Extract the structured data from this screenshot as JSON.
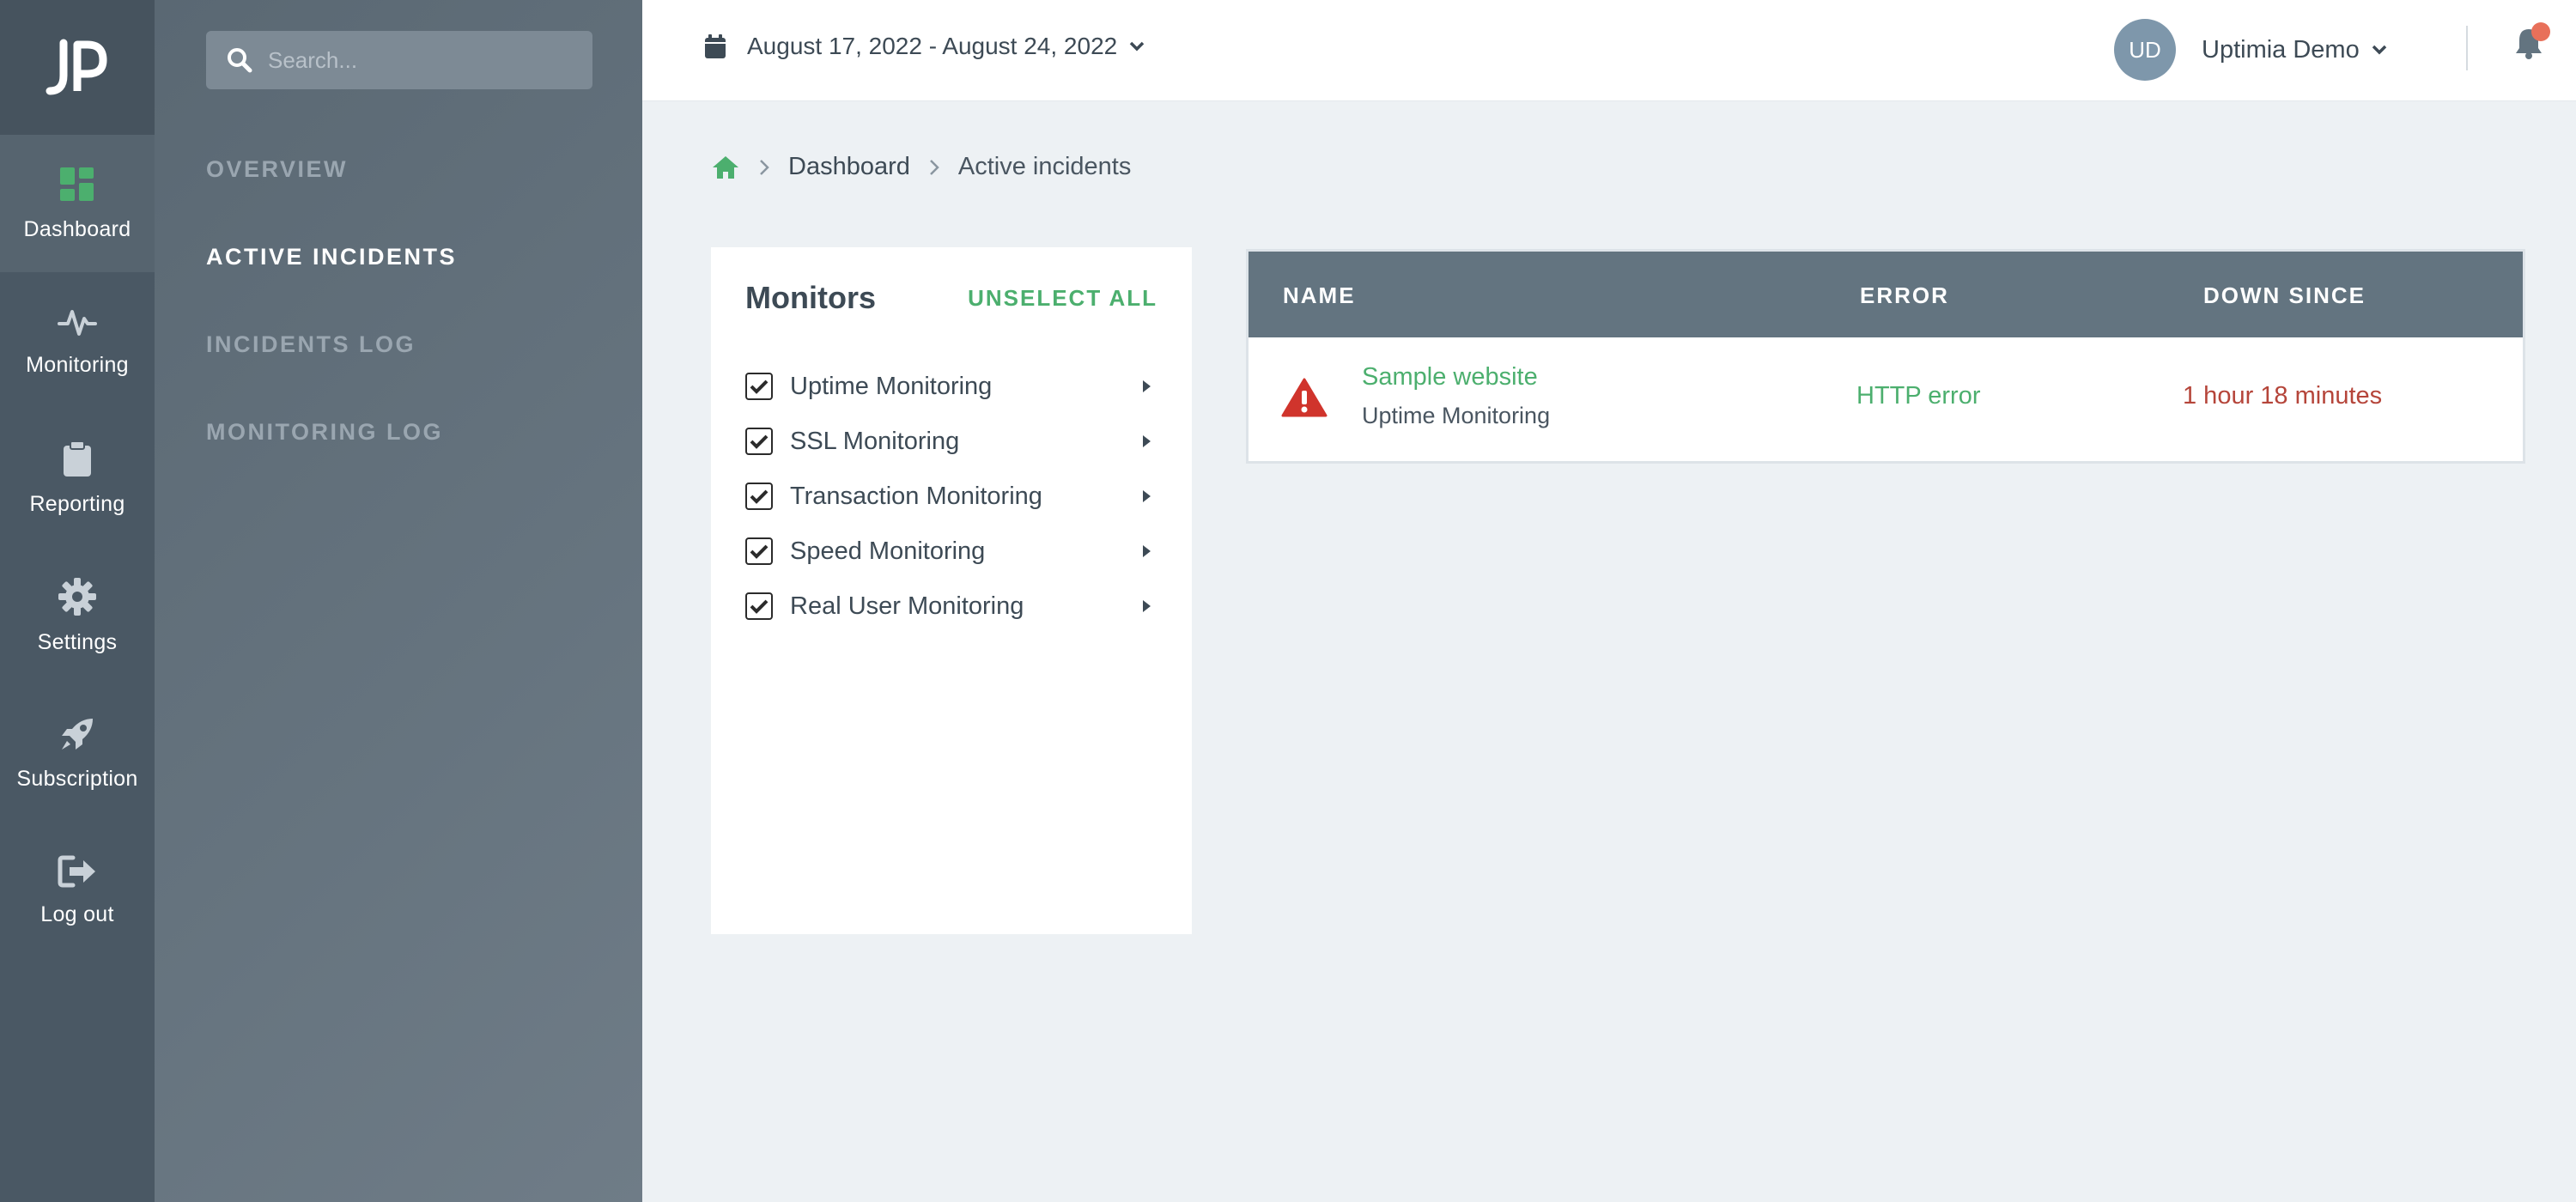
{
  "app": {
    "name": "Uptimia",
    "logo_icon": "jp-logo-icon"
  },
  "rail": {
    "items": [
      {
        "label": "Dashboard",
        "icon": "dashboard-grid-icon",
        "active": true
      },
      {
        "label": "Monitoring",
        "icon": "pulse-icon",
        "active": false
      },
      {
        "label": "Reporting",
        "icon": "clipboard-icon",
        "active": false
      },
      {
        "label": "Settings",
        "icon": "gear-icon",
        "active": false
      },
      {
        "label": "Subscription",
        "icon": "rocket-icon",
        "active": false
      },
      {
        "label": "Log out",
        "icon": "logout-icon",
        "active": false
      }
    ]
  },
  "subnav": {
    "search_placeholder": "Search...",
    "items": [
      {
        "label": "OVERVIEW",
        "active": false
      },
      {
        "label": "ACTIVE INCIDENTS",
        "active": true
      },
      {
        "label": "INCIDENTS LOG",
        "active": false
      },
      {
        "label": "MONITORING LOG",
        "active": false
      }
    ]
  },
  "topbar": {
    "date_range": "August 17, 2022 - August 24, 2022",
    "user_initials": "UD",
    "user_name": "Uptimia Demo",
    "notification_indicator": true
  },
  "breadcrumb": {
    "home_icon": "home-icon",
    "items": [
      "Dashboard",
      "Active incidents"
    ]
  },
  "monitors": {
    "title": "Monitors",
    "unselect_all": "UNSELECT ALL",
    "items": [
      {
        "label": "Uptime Monitoring",
        "checked": true
      },
      {
        "label": "SSL Monitoring",
        "checked": true
      },
      {
        "label": "Transaction Monitoring",
        "checked": true
      },
      {
        "label": "Speed Monitoring",
        "checked": true
      },
      {
        "label": "Real User Monitoring",
        "checked": true
      }
    ]
  },
  "incidents": {
    "columns": [
      "NAME",
      "ERROR",
      "DOWN SINCE"
    ],
    "rows": [
      {
        "name": "Sample website",
        "type": "Uptime Monitoring",
        "error": "HTTP error",
        "down_since": "1 hour 18 minutes",
        "icon": "warning-triangle-icon"
      }
    ]
  },
  "colors": {
    "accent_green": "#4caf6e",
    "error_red": "#b5453a",
    "warning_red": "#d0342c",
    "rail_bg": "#4a5864",
    "table_header_bg": "#637480"
  }
}
